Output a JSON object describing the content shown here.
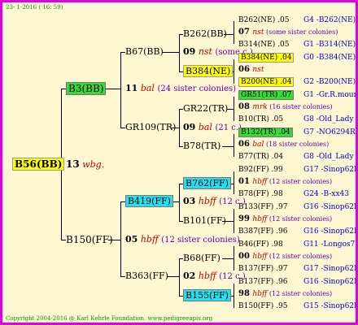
{
  "header": "23-  1-2016 ( 16: 59)",
  "footer": "Copyright 2004-2016 @ Karl Kehrle Foundation.   www.pedigreeapis.org",
  "root": {
    "label": "B56(BB)",
    "num": "13",
    "mark": "wbg."
  },
  "gen1": [
    {
      "label": "B3(BB)",
      "num": "11",
      "mark": "bal",
      "note": "(24 sister colonies)"
    },
    {
      "label": "B150(FF)",
      "num": "05",
      "mark": "hbff",
      "note": "(12 sister colonies)"
    }
  ],
  "gen2": [
    {
      "label": "B67(BB)",
      "num": "09",
      "mark": "nst",
      "note": "(some c.)"
    },
    {
      "label": "GR109(TR)",
      "num": "09",
      "mark": "bal",
      "note": "(21 c.)"
    },
    {
      "label": "B419(FF)",
      "num": "03",
      "mark": "hbff",
      "note": "(12 c.)"
    },
    {
      "label": "B363(FF)",
      "num": "02",
      "mark": "hbff",
      "note": "(12 c.)"
    }
  ],
  "gen3": [
    {
      "label": "B262(BB)"
    },
    {
      "label": "B384(NE)"
    },
    {
      "label": "GR22(TR)"
    },
    {
      "label": "B78(TR)"
    },
    {
      "label": "B762(FF)"
    },
    {
      "label": "B101(FF)"
    },
    {
      "label": "B68(FF)"
    },
    {
      "label": "B155(FF)"
    }
  ],
  "gen4": [
    {
      "label": "B262(NE)",
      "val": ".05",
      "right": "G4 -B262(NE)"
    },
    {
      "num": "07",
      "mark": "nst",
      "note": "(some sister colonies)"
    },
    {
      "label": "B314(NE)",
      "val": ".05",
      "right": "G1 -B314(NE)"
    },
    {
      "label": "B384(NE)",
      "val": ".04",
      "right": "G0 -B384(NE)"
    },
    {
      "num": "06",
      "mark": "nst"
    },
    {
      "label": "B200(NE)",
      "val": ".04",
      "right": "G2 -B200(NE)"
    },
    {
      "label": "GR51(TR)",
      "val": ".07",
      "right": "G1 -Gr.R.mounta"
    },
    {
      "num": "08",
      "mark": "mrk",
      "note": "(16 sister colonies)"
    },
    {
      "label": "B10(TR)",
      "val": ".05",
      "right": "G8 -Old_Lady"
    },
    {
      "label": "B132(TR)",
      "val": ".04",
      "right": "G7 -NO6294R"
    },
    {
      "num": "06",
      "mark": "bal",
      "note": "(18 sister colonies)"
    },
    {
      "label": "B77(TR)",
      "val": ".04",
      "right": "G8 -Old_Lady"
    },
    {
      "label": "B92(FF)",
      "val": ".99",
      "right": "G17 -Sinop62R"
    },
    {
      "num": "01",
      "mark": "hbff",
      "note": "(12 sister colonies)"
    },
    {
      "label": "B78(FF)",
      "val": ".98",
      "right": "G24 -B-xx43"
    },
    {
      "label": "B133(FF)",
      "val": ".97",
      "right": "G16 -Sinop62R"
    },
    {
      "num": "99",
      "mark": "hbff",
      "note": "(12 sister colonies)"
    },
    {
      "label": "B387(FF)",
      "val": ".96",
      "right": "G16 -Sinop62R"
    },
    {
      "label": "B46(FF)",
      "val": ".98",
      "right": "G11 -Longos77R"
    },
    {
      "num": "00",
      "mark": "hbff",
      "note": "(12 sister colonies)"
    },
    {
      "label": "B137(FF)",
      "val": ".97",
      "right": "G17 -Sinop62R"
    },
    {
      "label": "B137(FF)",
      "val": ".96",
      "right": "G16 -Sinop62R"
    },
    {
      "num": "98",
      "mark": "hbff",
      "note": "(12 sister colonies)"
    },
    {
      "label": "B150(FF)",
      "val": ".95",
      "right": "G15 -Sinop62R"
    }
  ],
  "colors": {
    "border": "#e000e0",
    "bg": "#fff6d2",
    "yellow": "#ffff00",
    "green": "#33dd33",
    "cyan": "#22e0f0",
    "link": "#0000cc",
    "mark": "#cc0000"
  }
}
